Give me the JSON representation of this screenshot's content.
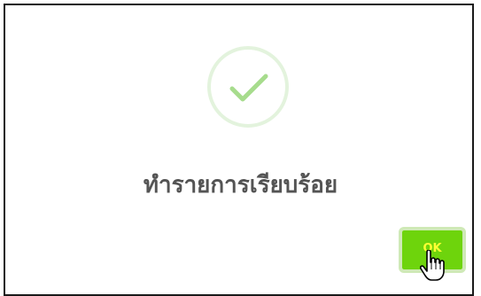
{
  "dialog": {
    "icon": "checkmark-success-icon",
    "message": "ทำรายการเรียบร้อย",
    "ok_label": "OK"
  },
  "colors": {
    "check": "#a7dc8d",
    "ring": "#e3f3dd",
    "ok_button": "#6ed40c",
    "ok_text": "#ffff33",
    "message_text": "#545454"
  },
  "cursor": {
    "icon": "hand-pointer-icon"
  }
}
